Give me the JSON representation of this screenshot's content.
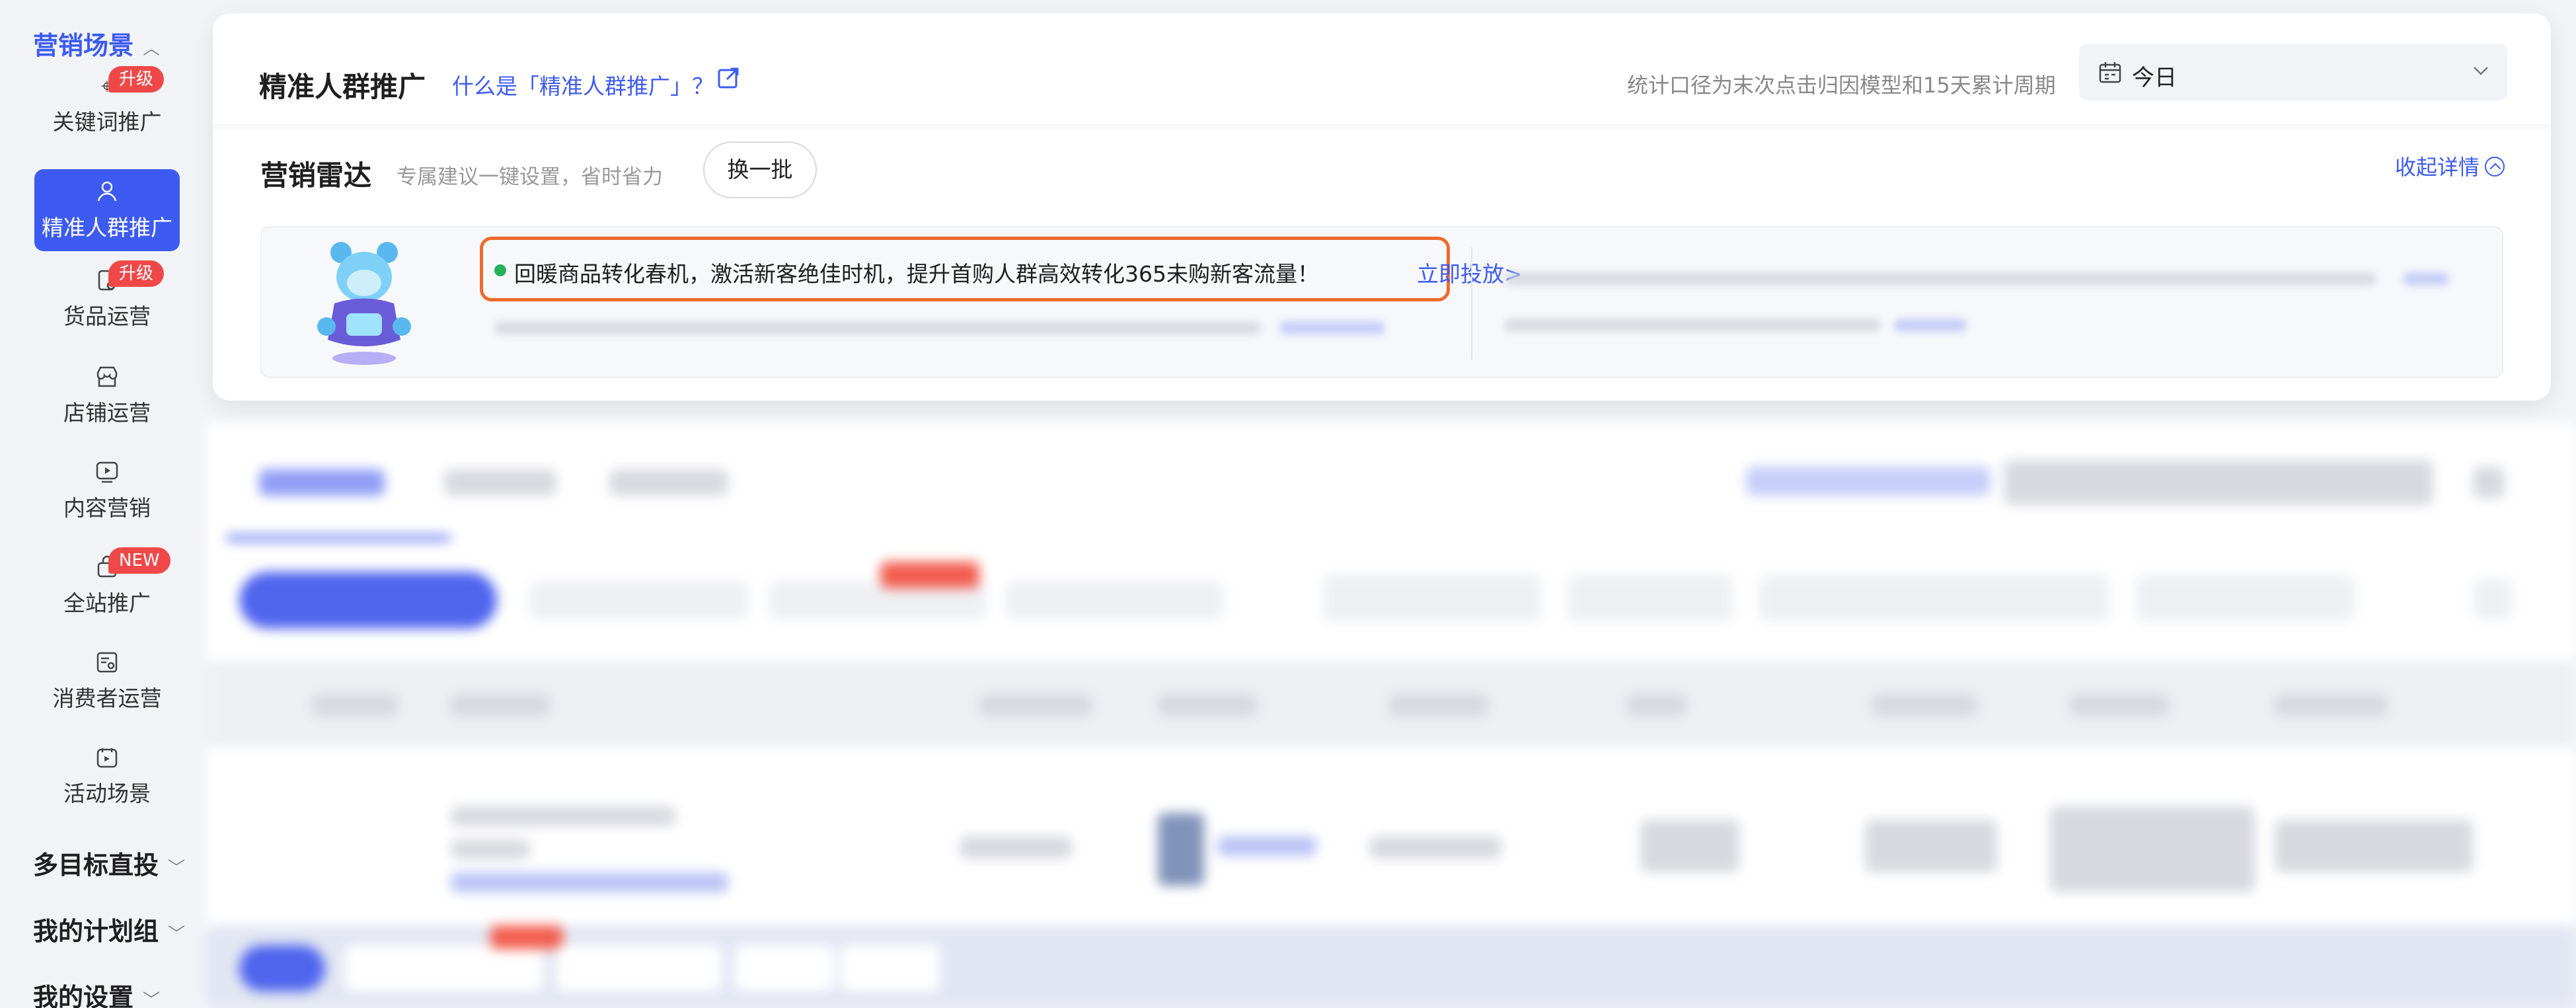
{
  "sidebar": {
    "section_marketing": "营销场景",
    "items": [
      {
        "label": "关键词推广",
        "icon": "crosshair-icon",
        "badge": "升级"
      },
      {
        "label": "精准人群推广",
        "icon": "person-icon",
        "badge": ""
      },
      {
        "label": "货品运营",
        "icon": "product-icon",
        "badge": "升级"
      },
      {
        "label": "店铺运营",
        "icon": "store-icon",
        "badge": ""
      },
      {
        "label": "内容营销",
        "icon": "play-icon",
        "badge": ""
      },
      {
        "label": "全站推广",
        "icon": "bag-icon",
        "badge": "NEW"
      },
      {
        "label": "消费者运营",
        "icon": "consumer-icon",
        "badge": ""
      },
      {
        "label": "活动场景",
        "icon": "activity-icon",
        "badge": ""
      }
    ],
    "section_multi": "多目标直投",
    "section_plan_group": "我的计划组",
    "section_settings": "我的设置"
  },
  "header": {
    "title": "精准人群推广",
    "help_link": "什么是「精准人群推广」？",
    "stat_note": "统计口径为末次点击归因模型和15天累计周期",
    "date_value": "今日"
  },
  "radar": {
    "title": "营销雷达",
    "subtitle": "专属建议一键设置，省时省力",
    "swap_button": "换一批",
    "collapse_label": "收起详情",
    "suggestion_text": "回暖商品转化春机，激活新客绝佳时机，提升首购人群高效转化365未购新客流量！",
    "suggestion_link": "立即投放>"
  },
  "colors": {
    "accent": "#3d5bf0",
    "badge_red": "#f04848",
    "highlight_orange": "#ec6a2a",
    "status_green": "#25b15b"
  }
}
